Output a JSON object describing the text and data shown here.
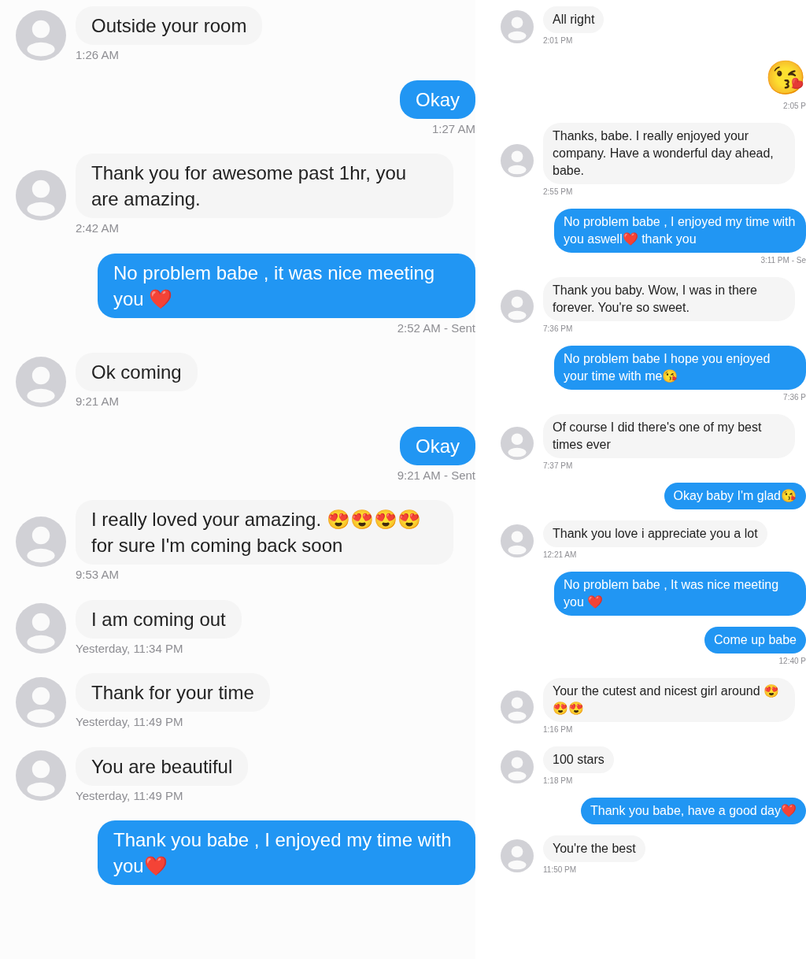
{
  "columns": [
    {
      "messages": [
        {
          "kind": "received",
          "text": "Outside your room",
          "time": "1:26 AM"
        },
        {
          "kind": "sent",
          "text": "Okay",
          "time": "1:27 AM"
        },
        {
          "kind": "received",
          "text": "Thank you for awesome past 1hr, you are amazing.",
          "time": "2:42 AM"
        },
        {
          "kind": "sent",
          "text": "No problem babe , it was nice meeting you ❤️",
          "time": "2:52 AM - Sent"
        },
        {
          "kind": "received",
          "text": "Ok coming",
          "time": "9:21 AM"
        },
        {
          "kind": "sent",
          "text": "Okay",
          "time": "9:21 AM - Sent"
        },
        {
          "kind": "received",
          "text": "I really loved your amazing. 😍😍😍😍 for sure I'm coming back soon",
          "time": "9:53 AM"
        },
        {
          "kind": "received",
          "text": "I am coming out",
          "time": "Yesterday, 11:34 PM"
        },
        {
          "kind": "received",
          "text": "Thank for your time",
          "time": "Yesterday, 11:49 PM"
        },
        {
          "kind": "received",
          "text": "You are beautiful",
          "time": "Yesterday, 11:49 PM"
        },
        {
          "kind": "sent",
          "text": "Thank you babe , I enjoyed my time with you❤️"
        }
      ]
    },
    {
      "messages": [
        {
          "kind": "received",
          "text": "All right",
          "time": "2:01 PM"
        },
        {
          "kind": "sent_emoji",
          "text": "😘",
          "time": "2:05 P"
        },
        {
          "kind": "received",
          "text": "Thanks, babe. I really enjoyed your company. Have a wonderful day ahead, babe.",
          "time": "2:55 PM"
        },
        {
          "kind": "sent",
          "text": "No problem babe , I enjoyed my time with you aswell❤️ thank you",
          "time": "3:11 PM - Se"
        },
        {
          "kind": "received",
          "text": "Thank you baby. Wow, I was in there forever. You're so sweet.",
          "time": "7:36 PM"
        },
        {
          "kind": "sent",
          "text": "No problem babe I hope you enjoyed your time with me😘",
          "time": "7:36 P"
        },
        {
          "kind": "received",
          "text": "Of course I did there's one of my best times ever",
          "time": "7:37 PM"
        },
        {
          "kind": "sent",
          "text": "Okay baby I'm glad😘"
        },
        {
          "kind": "received",
          "text": "Thank you love i appreciate you a lot",
          "time": "12:21 AM"
        },
        {
          "kind": "sent",
          "text": "No problem babe , It was nice meeting you ❤️"
        },
        {
          "kind": "sent",
          "text": "Come up babe",
          "time": "12:40 P"
        },
        {
          "kind": "received",
          "text": "Your the cutest and nicest girl around 😍😍😍",
          "time": "1:16 PM"
        },
        {
          "kind": "received",
          "text": "100 stars",
          "time": "1:18 PM"
        },
        {
          "kind": "sent",
          "text": "Thank you babe, have a good day❤️"
        },
        {
          "kind": "received",
          "text": "You're the best",
          "time": "11:50 PM"
        }
      ]
    }
  ]
}
